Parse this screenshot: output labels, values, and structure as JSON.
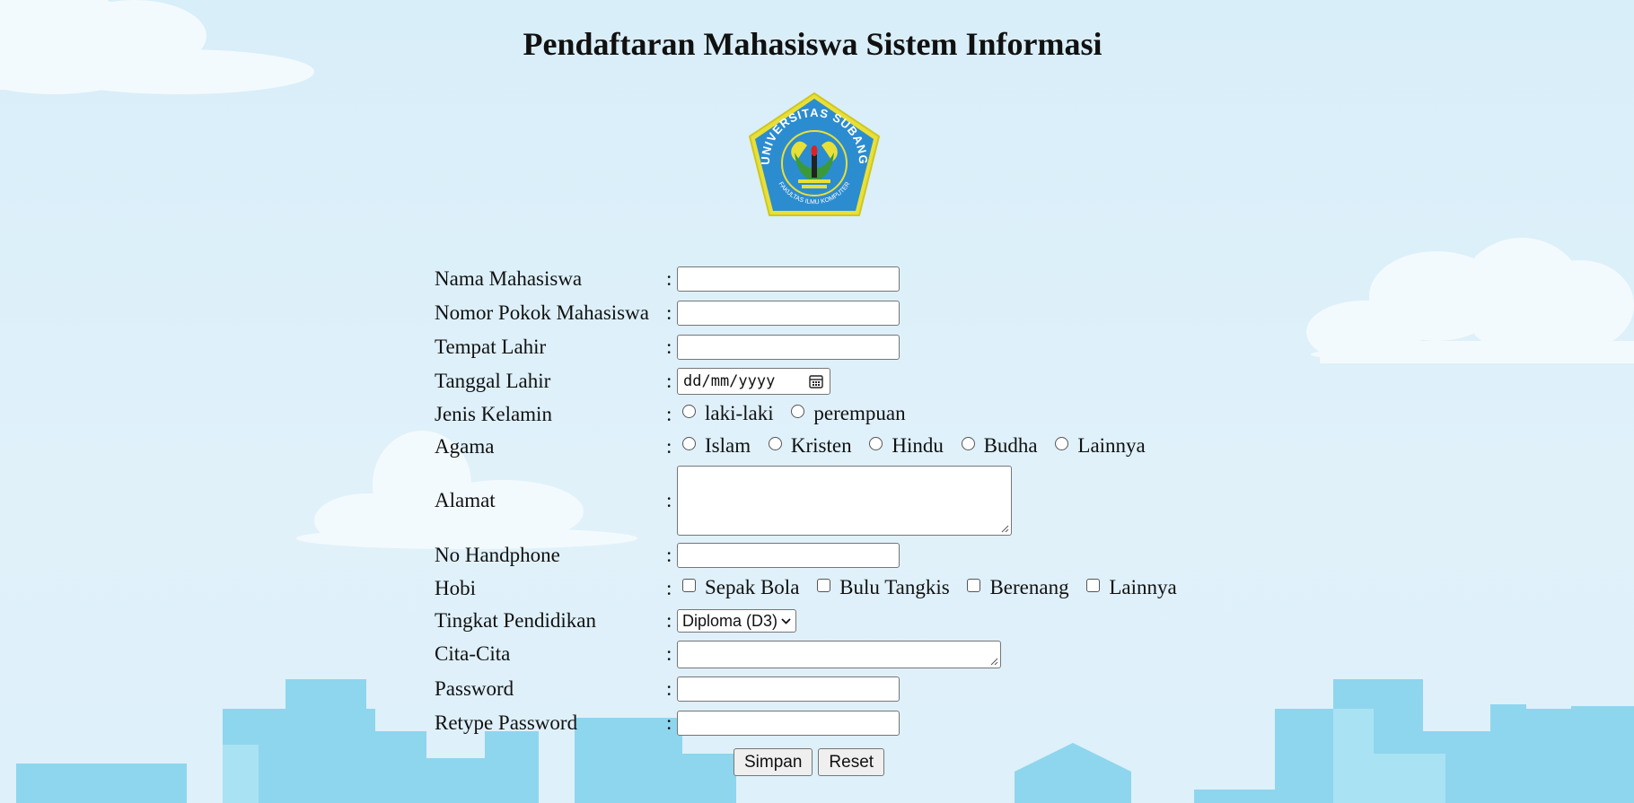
{
  "page": {
    "title": "Pendaftaran Mahasiswa Sistem Informasi"
  },
  "logo": {
    "top_text": "UNIVERSITAS SUBANG",
    "bottom_text": "FAKULTAS ILMU KOMPUTER"
  },
  "form": {
    "colon": ":",
    "nama": {
      "label": "Nama Mahasiswa",
      "value": ""
    },
    "npm": {
      "label": "Nomor Pokok Mahasiswa",
      "value": ""
    },
    "tempat_lahir": {
      "label": "Tempat Lahir",
      "value": ""
    },
    "tanggal_lahir": {
      "label": "Tanggal Lahir",
      "placeholder": "dd/mm/yyyy"
    },
    "jenis_kelamin": {
      "label": "Jenis Kelamin",
      "options": [
        "laki-laki",
        "perempuan"
      ]
    },
    "agama": {
      "label": "Agama",
      "options": [
        "Islam",
        "Kristen",
        "Hindu",
        "Budha",
        "Lainnya"
      ]
    },
    "alamat": {
      "label": "Alamat",
      "value": ""
    },
    "no_hp": {
      "label": "No Handphone",
      "value": ""
    },
    "hobi": {
      "label": "Hobi",
      "options": [
        "Sepak Bola",
        "Bulu Tangkis",
        "Berenang",
        "Lainnya"
      ]
    },
    "pendidikan": {
      "label": "Tingkat Pendidikan",
      "selected": "Diploma (D3)"
    },
    "cita_cita": {
      "label": "Cita-Cita",
      "value": ""
    },
    "password": {
      "label": "Password",
      "value": ""
    },
    "retype_password": {
      "label": "Retype Password",
      "value": ""
    }
  },
  "buttons": {
    "submit": "Simpan",
    "reset": "Reset"
  }
}
